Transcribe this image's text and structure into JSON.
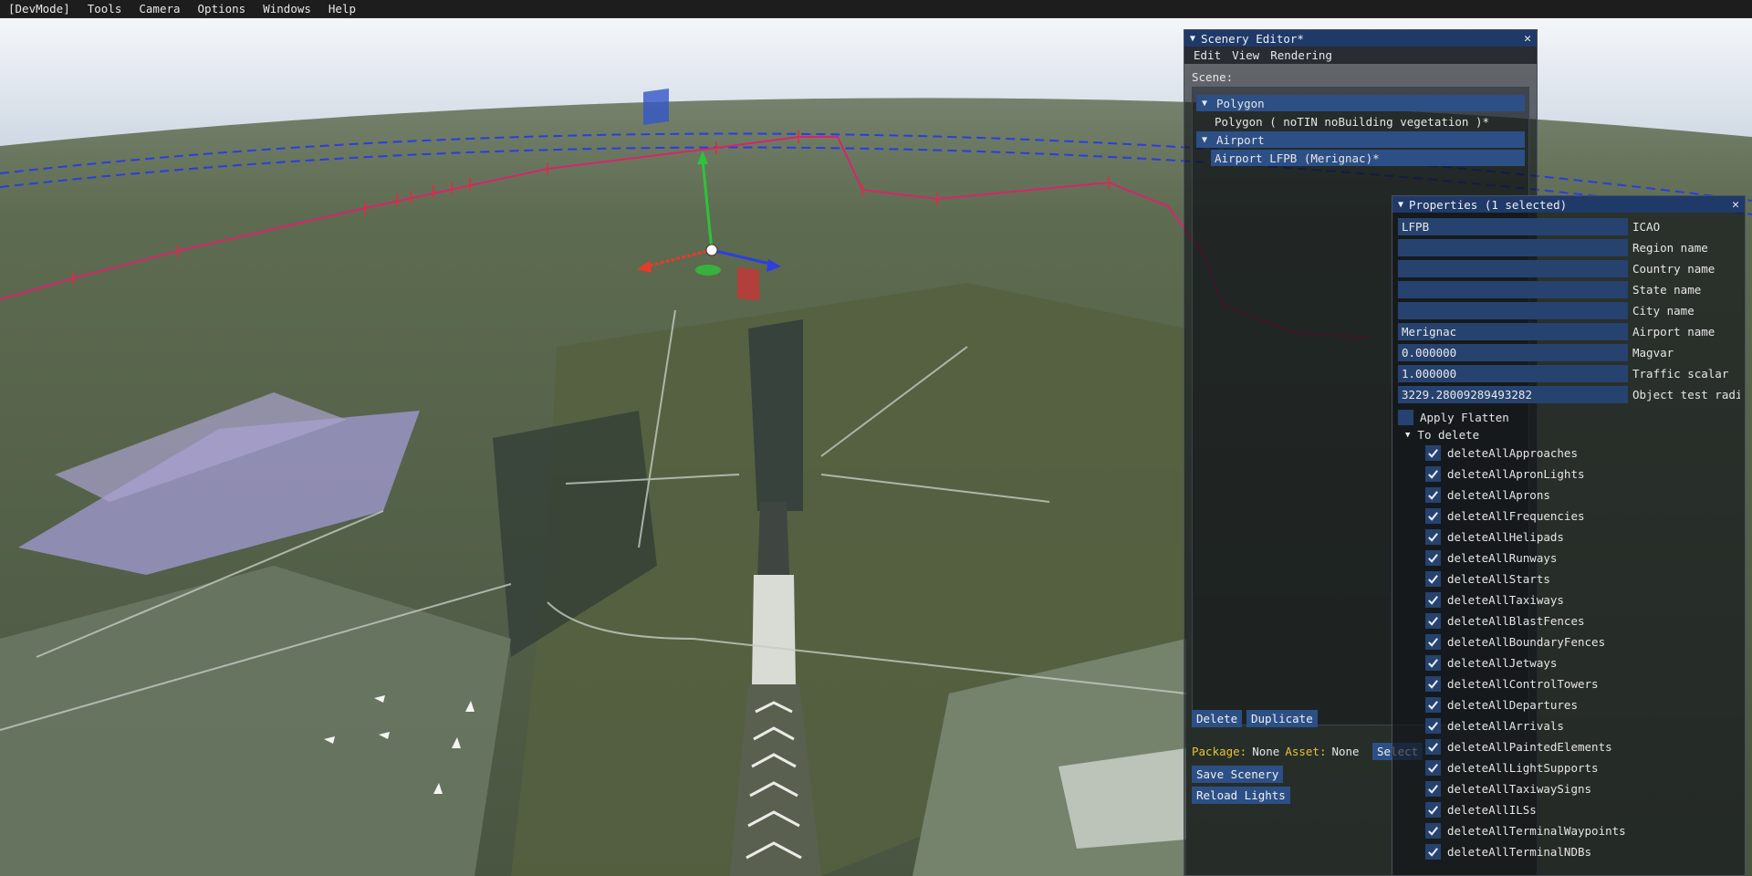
{
  "menubar": {
    "items": [
      "[DevMode]",
      "Tools",
      "Camera",
      "Options",
      "Windows",
      "Help"
    ]
  },
  "scenery_editor": {
    "title": "Scenery Editor*",
    "menu": [
      "Edit",
      "View",
      "Rendering"
    ],
    "scene_label": "Scene:",
    "tree": [
      {
        "header": "Polygon",
        "child": "Polygon  ( noTIN noBuilding vegetation )*"
      },
      {
        "header": "Airport",
        "child": "Airport LFPB (Merignac)*"
      }
    ],
    "delete_label": "Delete",
    "duplicate_label": "Duplicate",
    "package_label": "Package:",
    "package_value": "None",
    "asset_label": "Asset:",
    "asset_value": "None",
    "select_label": "Select",
    "save_label": "Save Scenery",
    "reload_label": "Reload Lights"
  },
  "properties": {
    "title": "Properties (1 selected)",
    "fields": [
      {
        "value": "LFPB",
        "label": "ICAO"
      },
      {
        "value": "",
        "label": "Region name"
      },
      {
        "value": "",
        "label": "Country name"
      },
      {
        "value": "",
        "label": "State name"
      },
      {
        "value": "",
        "label": "City name"
      },
      {
        "value": "Merignac",
        "label": "Airport name"
      },
      {
        "value": "0.000000",
        "label": "Magvar"
      },
      {
        "value": "1.000000",
        "label": "Traffic scalar"
      },
      {
        "value": "3229.28009289493282",
        "label": "Object test radius"
      }
    ],
    "apply_flatten": {
      "label": "Apply Flatten",
      "checked": false
    },
    "to_delete_label": "To delete",
    "to_delete": [
      "deleteAllApproaches",
      "deleteAllApronLights",
      "deleteAllAprons",
      "deleteAllFrequencies",
      "deleteAllHelipads",
      "deleteAllRunways",
      "deleteAllStarts",
      "deleteAllTaxiways",
      "deleteAllBlastFences",
      "deleteAllBoundaryFences",
      "deleteAllJetways",
      "deleteAllControlTowers",
      "deleteAllDepartures",
      "deleteAllArrivals",
      "deleteAllPaintedElements",
      "deleteAllLightSupports",
      "deleteAllTaxiwaySigns",
      "deleteAllILSs",
      "deleteAllTerminalWaypoints",
      "deleteAllTerminalNDBs"
    ]
  },
  "colors": {
    "accent": "#2c4f86",
    "title_bar": "#1f3a69",
    "package_label": "#e6c23b",
    "boundary": "#d8246a",
    "gizmo_x": "#e83a2a",
    "gizmo_y": "#2fc23a",
    "gizmo_z": "#2c3fe0"
  }
}
